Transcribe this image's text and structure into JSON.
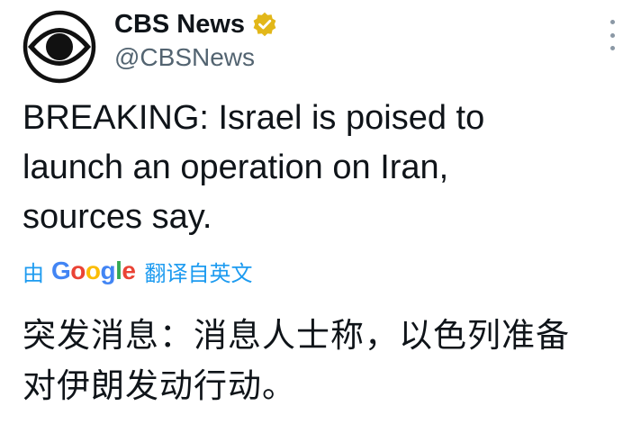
{
  "author": {
    "display_name": "CBS News",
    "handle": "@CBSNews",
    "avatar_icon": "cbs-eye-logo-icon",
    "verified_badge_icon": "verified-gold-badge-icon",
    "badge_color": "#e2b719"
  },
  "more_menu_icon": "vertical-ellipsis-icon",
  "tweet": {
    "text": "BREAKING: Israel is poised to\nlaunch an operation on Iran,\nsources say."
  },
  "translation": {
    "prefix": "由",
    "provider": {
      "letters": [
        "G",
        "o",
        "o",
        "g",
        "l",
        "e"
      ],
      "colors": [
        "#4285F4",
        "#EA4335",
        "#FBBC05",
        "#4285F4",
        "#34A853",
        "#EA4335"
      ]
    },
    "suffix": "翻译自英文",
    "link_color": "#1d9bf0",
    "translated_text": "突发消息：消息人士称，以色列准备\n对伊朗发动行动。"
  }
}
